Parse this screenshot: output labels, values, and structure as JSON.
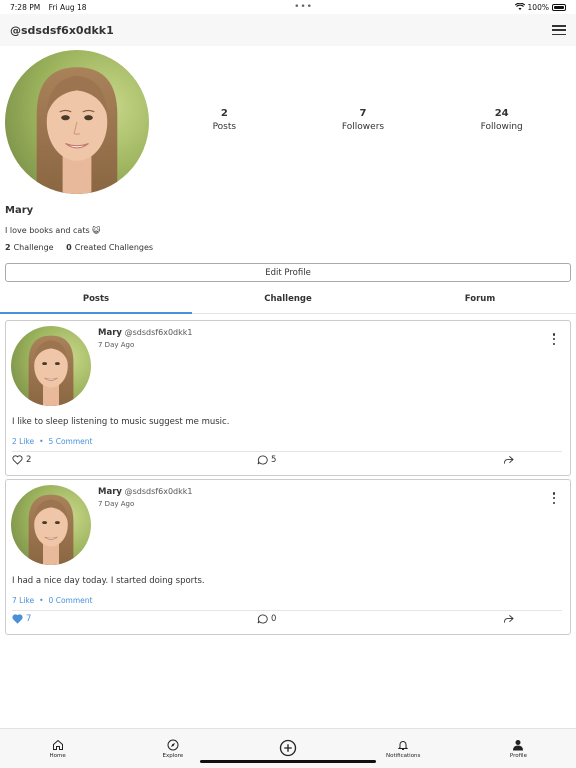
{
  "status_bar": {
    "time": "7:28 PM",
    "date": "Fri Aug 18",
    "battery": "100%"
  },
  "header": {
    "username": "@sdsdsf6x0dkk1",
    "menu_icon": "hamburger-icon"
  },
  "profile": {
    "name": "Mary",
    "bio": "I love books and cats 😺",
    "stats": [
      {
        "value": "2",
        "label": "Posts"
      },
      {
        "value": "7",
        "label": "Followers"
      },
      {
        "value": "24",
        "label": "Following"
      }
    ],
    "challenge_count": "2",
    "challenge_label": "Challenge",
    "created_count": "0",
    "created_label": "Created Challenges",
    "edit_label": "Edit Profile"
  },
  "tabs": [
    {
      "label": "Posts",
      "active": true
    },
    {
      "label": "Challenge",
      "active": false
    },
    {
      "label": "Forum",
      "active": false
    }
  ],
  "posts": [
    {
      "name": "Mary",
      "handle": "@sdsdsf6x0dkk1",
      "time": "7 Day Ago",
      "content": "I like to sleep listening to music suggest me music.",
      "likes_text": "2 Like",
      "separator": "•",
      "comments_text": "5 Comment",
      "like_count": "2",
      "comment_count": "5",
      "liked": false
    },
    {
      "name": "Mary",
      "handle": "@sdsdsf6x0dkk1",
      "time": "7 Day Ago",
      "content": "I had a nice day today.  I started doing sports.",
      "likes_text": "7 Like",
      "separator": "•",
      "comments_text": "0 Comment",
      "like_count": "7",
      "comment_count": "0",
      "liked": true
    }
  ],
  "bottom_nav": [
    {
      "label": "Home",
      "icon": "home-icon"
    },
    {
      "label": "Explore",
      "icon": "compass-icon"
    },
    {
      "label": "",
      "icon": "plus-circle-icon"
    },
    {
      "label": "Notifications",
      "icon": "bell-icon"
    },
    {
      "label": "Profile",
      "icon": "person-icon"
    }
  ],
  "colors": {
    "accent": "#4a90d9",
    "text": "#333333",
    "border": "#cccccc"
  }
}
